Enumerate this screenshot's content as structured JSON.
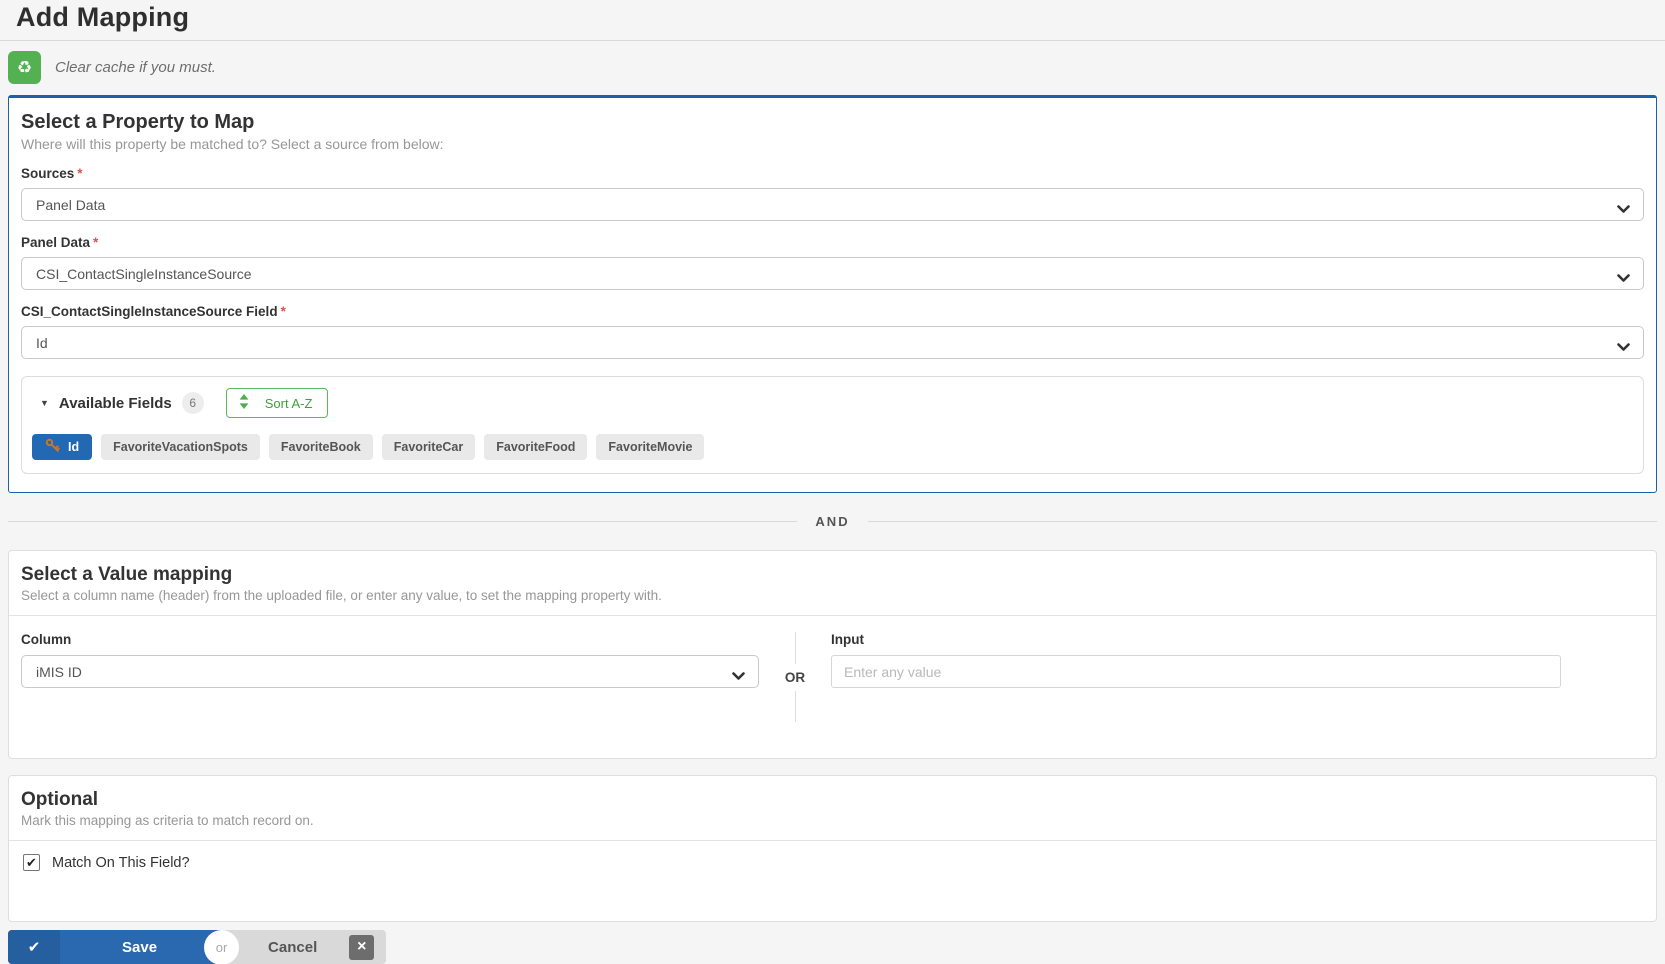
{
  "page": {
    "title": "Add Mapping"
  },
  "alert": {
    "text": "Clear cache if you must."
  },
  "required_mark": "*",
  "property_section": {
    "title": "Select a Property to Map",
    "subtitle": "Where will this property be matched to? Select a source from below:",
    "fields": [
      {
        "label": "Sources",
        "value": "Panel Data"
      },
      {
        "label": "Panel Data",
        "value": "CSI_ContactSingleInstanceSource"
      },
      {
        "label": "CSI_ContactSingleInstanceSource Field",
        "value": "Id"
      }
    ],
    "available_fields": {
      "label": "Available Fields",
      "count": "6",
      "sort_label": "Sort A-Z",
      "chips": [
        {
          "label": "Id"
        },
        {
          "label": "FavoriteVacationSpots"
        },
        {
          "label": "FavoriteBook"
        },
        {
          "label": "FavoriteCar"
        },
        {
          "label": "FavoriteFood"
        },
        {
          "label": "FavoriteMovie"
        }
      ]
    }
  },
  "and_divider": "AND",
  "value_section": {
    "title": "Select a Value mapping",
    "subtitle": "Select a column name (header) from the uploaded file, or enter any value, to set the mapping property with.",
    "column_label": "Column",
    "column_value": "iMIS ID",
    "or_label": "OR",
    "input_label": "Input",
    "input_placeholder": "Enter any value"
  },
  "optional_section": {
    "title": "Optional",
    "subtitle": "Mark this mapping as criteria to match record on.",
    "checkbox_label": "Match On This Field?"
  },
  "actions": {
    "save_label": "Save",
    "or_label": "or",
    "cancel_label": "Cancel"
  },
  "icons": {
    "recycle": "♻",
    "caret_down": "▼",
    "check": "✔",
    "close": "×"
  },
  "colors": {
    "accent_blue": "#2a68b0",
    "panel_border_blue": "#1e5fa8",
    "green": "#53b152",
    "chip_selected_blue": "#2268b2",
    "key_orange": "#c8762a",
    "required_red": "#d9534f"
  }
}
